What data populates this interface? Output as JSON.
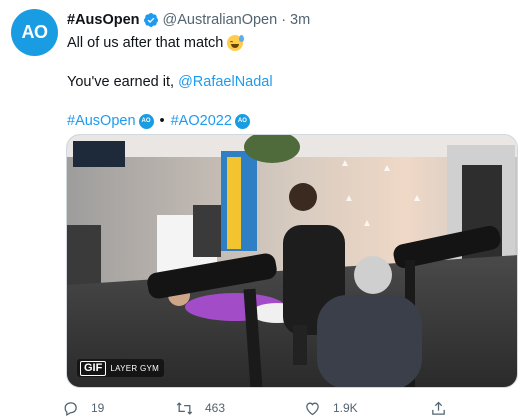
{
  "tweet": {
    "avatar_text": "AO",
    "display_name": "#AusOpen",
    "handle": "@AustralianOpen",
    "separator": "·",
    "time": "3m",
    "text_line1": "All of us after that match",
    "text_line2_prefix": "You've earned it, ",
    "text_line2_mention": "@RafaelNadal",
    "hashtag1": "#AusOpen",
    "hashtag_bullet": "•",
    "hashtag2": "#AO2022",
    "hashflag_text": "AO"
  },
  "media": {
    "type": "GIF",
    "gif_label": "GIF",
    "caption": "LAYER GYM"
  },
  "actions": {
    "reply_count": "19",
    "retweet_count": "463",
    "like_count": "1.9K"
  },
  "colors": {
    "accent": "#1d9bf0",
    "ao_blue": "#1a9ce3",
    "secondary_text": "#536471"
  },
  "icons": [
    "verified-badge-icon",
    "grinning-sweat-emoji-icon",
    "ao-hashflag-icon",
    "reply-icon",
    "retweet-icon",
    "like-icon",
    "share-icon"
  ]
}
